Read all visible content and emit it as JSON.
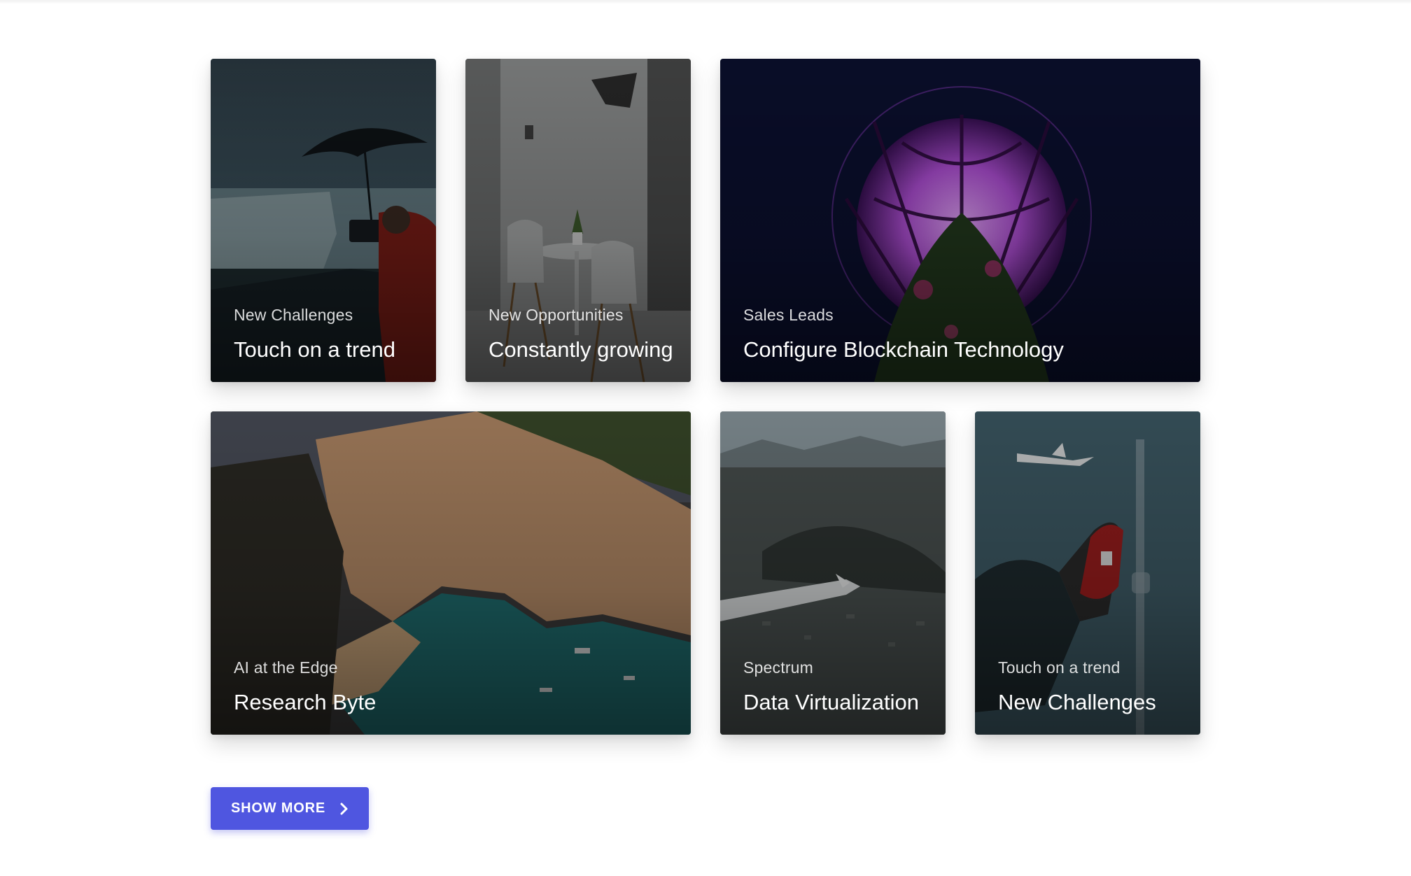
{
  "cards": [
    {
      "kicker": "New Challenges",
      "title": "Touch on a trend"
    },
    {
      "kicker": "New Opportunities",
      "title": "Constantly growing"
    },
    {
      "kicker": "Sales Leads",
      "title": "Configure Blockchain Technology"
    },
    {
      "kicker": "AI at the Edge",
      "title": "Research Byte"
    },
    {
      "kicker": "Spectrum",
      "title": "Data Virtualization"
    },
    {
      "kicker": "Touch on a trend",
      "title": "New Challenges"
    }
  ],
  "show_more": {
    "label": "SHOW MORE",
    "icon": "chevron-right-icon"
  },
  "colors": {
    "accent": "#4f56e0"
  }
}
